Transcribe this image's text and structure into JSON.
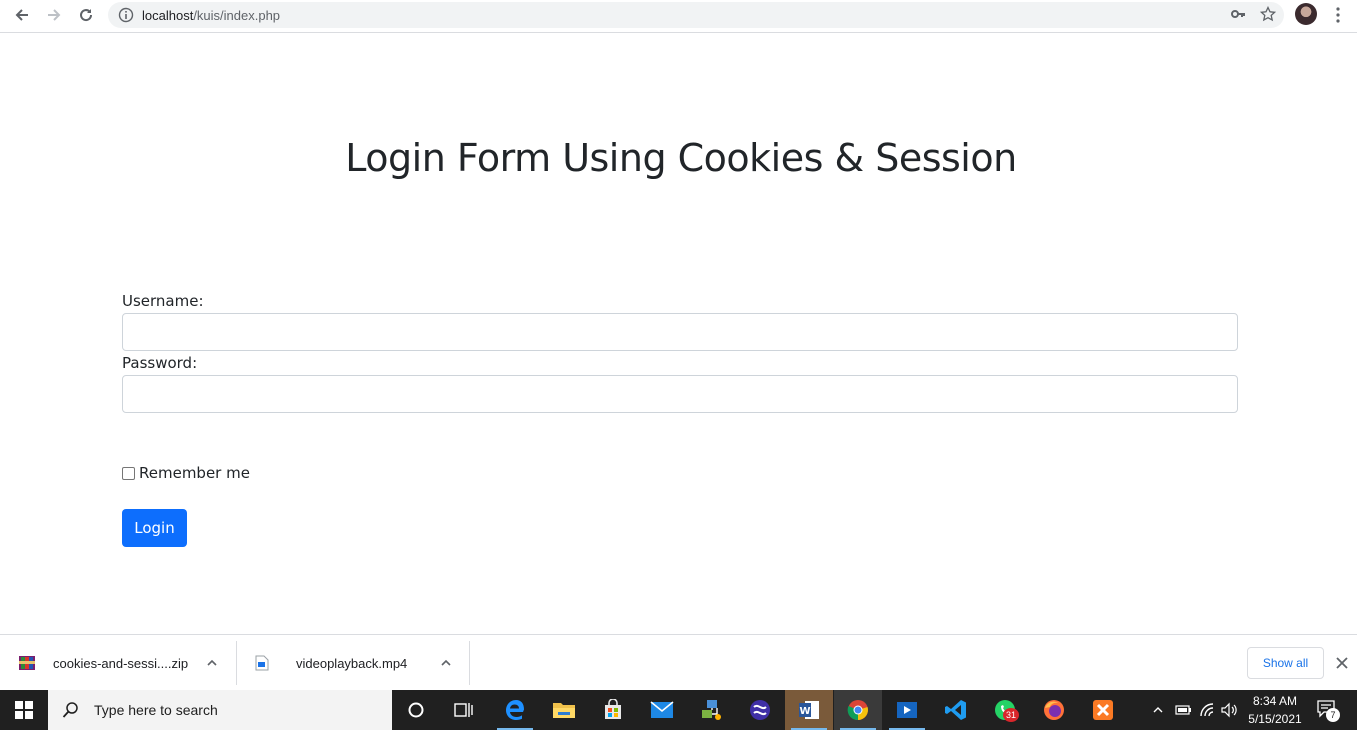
{
  "browser": {
    "url_host": "localhost",
    "url_path": "/kuis/index.php"
  },
  "page": {
    "title": "Login Form Using Cookies & Session",
    "username_label": "Username:",
    "username_value": "",
    "password_label": "Password:",
    "password_value": "",
    "remember_label": "Remember me",
    "remember_checked": false,
    "login_button": "Login"
  },
  "downloads": {
    "items": [
      {
        "name": "cookies-and-sessi....zip",
        "icon": "winrar-archive-icon"
      },
      {
        "name": "videoplayback.mp4",
        "icon": "video-file-icon"
      }
    ],
    "show_all": "Show all"
  },
  "taskbar": {
    "search_placeholder": "Type here to search",
    "time": "8:34 AM",
    "date": "5/15/2021",
    "whatsapp_badge": "31",
    "notification_count": "7",
    "apps": [
      "cortana-icon",
      "task-view-icon",
      "edge-icon",
      "file-explorer-icon",
      "store-icon",
      "mail-icon",
      "network-app-icon",
      "app-icon",
      "word-icon",
      "chrome-icon",
      "media-player-icon",
      "vscode-icon",
      "whatsapp-icon",
      "firefox-icon",
      "xampp-icon"
    ]
  },
  "colors": {
    "primary": "#0d6efd",
    "taskbar": "#202020"
  }
}
